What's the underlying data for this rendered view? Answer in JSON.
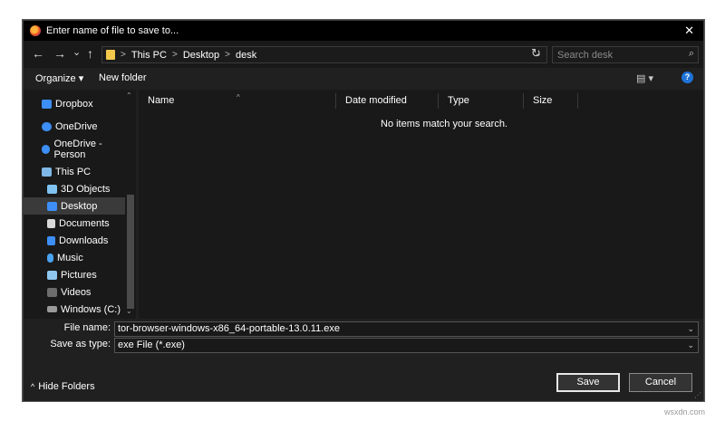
{
  "window": {
    "title": "Enter name of file to save to...",
    "close_glyph": "✕"
  },
  "nav": {
    "back": "←",
    "forward": "→",
    "recent": "⌄",
    "up": "↑",
    "refresh": "↻"
  },
  "breadcrumb": [
    "This PC",
    "Desktop",
    "desk"
  ],
  "breadcrumb_sep": ">",
  "search": {
    "placeholder": "Search desk",
    "icon": "⌕"
  },
  "toolbar": {
    "organize_label": "Organize ▾",
    "new_folder_label": "New folder",
    "view_glyph": "▤ ▾",
    "help_glyph": "?"
  },
  "sidebar": {
    "items": [
      {
        "label": "Dropbox",
        "icon": "dropbox-icon",
        "color": "#3d8ef7"
      },
      {
        "label": "OneDrive",
        "icon": "onedrive-icon",
        "color": "#3d8ef7"
      },
      {
        "label": "OneDrive - Person",
        "icon": "onedrive-icon",
        "color": "#3d8ef7"
      },
      {
        "label": "This PC",
        "icon": "computer-icon",
        "color": "#7fb8e6"
      },
      {
        "label": "3D Objects",
        "icon": "cube-icon",
        "color": "#7fc3f0"
      },
      {
        "label": "Desktop",
        "icon": "desktop-icon",
        "color": "#3d8ef7",
        "selected": true
      },
      {
        "label": "Documents",
        "icon": "document-icon",
        "color": "#d9d9d9"
      },
      {
        "label": "Downloads",
        "icon": "download-icon",
        "color": "#3d8ef7"
      },
      {
        "label": "Music",
        "icon": "music-icon",
        "color": "#4aa3f0"
      },
      {
        "label": "Pictures",
        "icon": "pictures-icon",
        "color": "#8fc7ef"
      },
      {
        "label": "Videos",
        "icon": "videos-icon",
        "color": "#6c6c6c"
      },
      {
        "label": "Windows (C:)",
        "icon": "drive-icon",
        "color": "#9a9a9a"
      }
    ]
  },
  "columns": [
    "Name",
    "Date modified",
    "Type",
    "Size"
  ],
  "empty_message": "No items match your search.",
  "form": {
    "file_name_label": "File name:",
    "file_name_value": "tor-browser-windows-x86_64-portable-13.0.11.exe",
    "save_type_label": "Save as type:",
    "save_type_value": "exe File (*.exe)"
  },
  "footer": {
    "hide_folders_label": "Hide Folders",
    "save_label": "Save",
    "cancel_label": "Cancel"
  },
  "watermark": "wsxdn.com"
}
